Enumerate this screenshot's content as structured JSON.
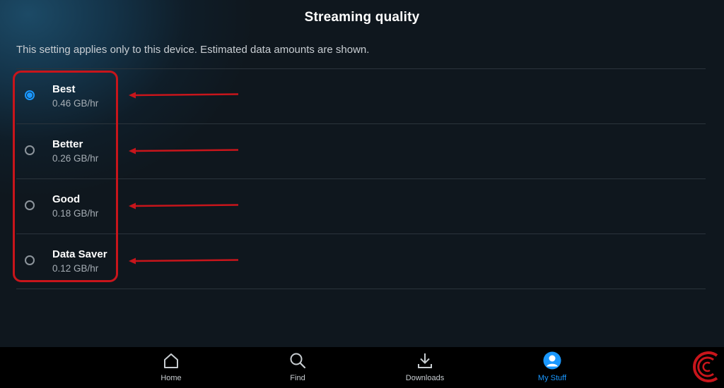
{
  "header": {
    "title": "Streaming quality"
  },
  "description": "This setting applies only to this device. Estimated data amounts are shown.",
  "options": [
    {
      "label": "Best",
      "size": "0.46 GB/hr",
      "selected": true
    },
    {
      "label": "Better",
      "size": "0.26 GB/hr",
      "selected": false
    },
    {
      "label": "Good",
      "size": "0.18 GB/hr",
      "selected": false
    },
    {
      "label": "Data Saver",
      "size": "0.12 GB/hr",
      "selected": false
    }
  ],
  "tabs": [
    {
      "label": "Home",
      "icon": "home-icon",
      "active": false
    },
    {
      "label": "Find",
      "icon": "search-icon",
      "active": false
    },
    {
      "label": "Downloads",
      "icon": "download-icon",
      "active": false
    },
    {
      "label": "My Stuff",
      "icon": "avatar-icon",
      "active": true
    }
  ],
  "colors": {
    "background": "#0f171e",
    "accent": "#1a98ff",
    "annotation": "#c8151b"
  }
}
